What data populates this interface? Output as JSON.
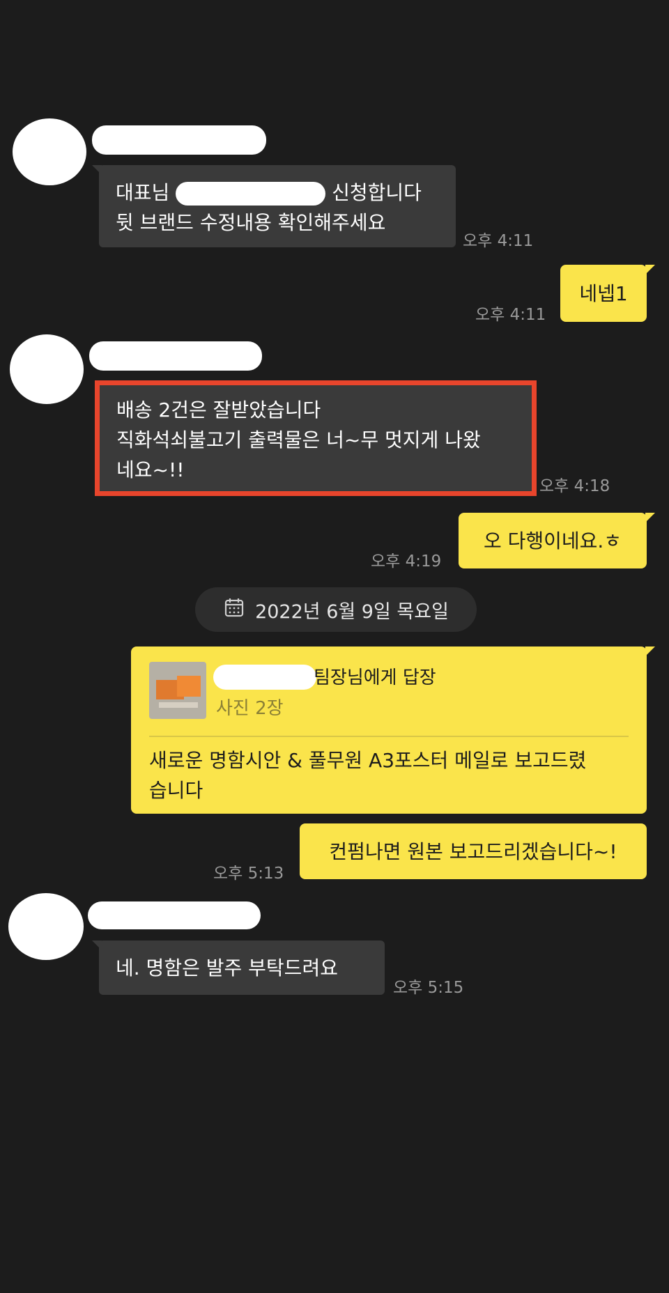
{
  "messages": [
    {
      "sender": "received",
      "text_before_redaction": "대표님",
      "text_after_redaction": "신청합니다",
      "line2": "뒷 브랜드 수정내용 확인해주세요",
      "time": "오후 4:11"
    },
    {
      "sender": "sent",
      "text": "네넵1",
      "time": "오후 4:11"
    },
    {
      "sender": "received",
      "highlighted": true,
      "lines": [
        "배송 2건은 잘받았습니다",
        "직화석쇠불고기 출력물은 너~무 멋지게 나왔",
        "네요~!!"
      ],
      "time": "오후 4:18"
    },
    {
      "sender": "sent",
      "text": "오 다행이네요.ㅎ",
      "time": "오후 4:19"
    }
  ],
  "date_divider": {
    "label": "2022년 6월 9일 목요일",
    "icon": "calendar-icon"
  },
  "reply_message": {
    "reply_target": "팀장님에게 답장",
    "reply_preview": "사진 2장",
    "lines": [
      "새로운 명함시안 & 풀무원 A3포스터 메일로 보고드렸",
      "습니다"
    ]
  },
  "followup_message": {
    "text": "컨펌나면 원본 보고드리겠습니다~!",
    "time": "오후 5:13"
  },
  "last_message": {
    "text": "네. 명함은 발주 부탁드려요",
    "time": "오후 5:15"
  },
  "colors": {
    "background": "#1c1c1c",
    "received_bubble": "#3a3a3a",
    "sent_bubble": "#fae44b",
    "highlight_border": "#e8452c"
  }
}
